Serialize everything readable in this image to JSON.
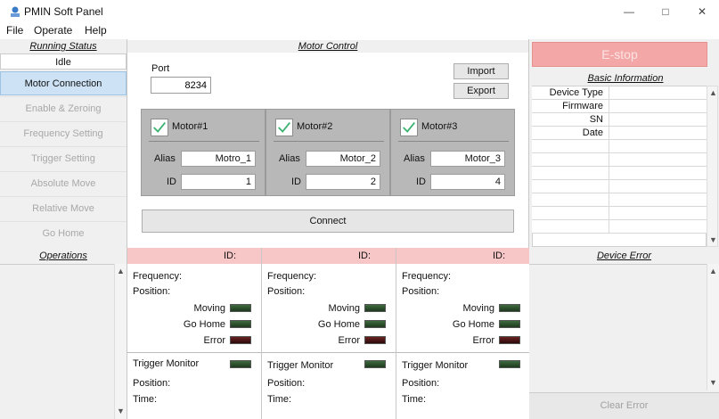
{
  "window": {
    "title": "PMIN Soft Panel",
    "minimize": "—",
    "maximize": "□",
    "close": "✕"
  },
  "menu": [
    "File",
    "Operate",
    "Help"
  ],
  "running_status": {
    "header": "Running Status",
    "value": "Idle"
  },
  "nav": [
    {
      "label": "Motor Connection",
      "active": true
    },
    {
      "label": "Enable & Zeroing",
      "active": false
    },
    {
      "label": "Frequency Setting",
      "active": false
    },
    {
      "label": "Trigger Setting",
      "active": false
    },
    {
      "label": "Absolute Move",
      "active": false
    },
    {
      "label": "Relative Move",
      "active": false
    },
    {
      "label": "Go Home",
      "active": false
    }
  ],
  "motor_control": {
    "header": "Motor Control",
    "port_label": "Port",
    "port_value": "8234",
    "import_label": "Import",
    "export_label": "Export",
    "connect_label": "Connect",
    "motors": [
      {
        "name": "Motor#1",
        "alias_label": "Alias",
        "alias": "Motro_1",
        "id_label": "ID",
        "id": "1"
      },
      {
        "name": "Motor#2",
        "alias_label": "Alias",
        "alias": "Motor_2",
        "id_label": "ID",
        "id": "2"
      },
      {
        "name": "Motor#3",
        "alias_label": "Alias",
        "alias": "Motor_3",
        "id_label": "ID",
        "id": "4"
      }
    ]
  },
  "estop_label": "E-stop",
  "basic_info": {
    "header": "Basic Information",
    "rows": [
      "Device Type",
      "Firmware",
      "SN",
      "Date"
    ]
  },
  "operations_header": "Operations",
  "monitors": [
    {
      "id_label": "ID:",
      "frequency": "Frequency:",
      "position": "Position:",
      "moving": "Moving",
      "go_home": "Go Home",
      "error": "Error",
      "trigger": "Trigger Monitor",
      "position2": "Position:",
      "time": "Time:"
    },
    {
      "id_label": "ID:",
      "frequency": "Frequency:",
      "position": "Position:",
      "moving": "Moving",
      "go_home": "Go Home",
      "error": "Error",
      "trigger": "Trigger Monitor",
      "position2": "Position:",
      "time": "Time:"
    },
    {
      "id_label": "ID:",
      "frequency": "Frequency:",
      "position": "Position:",
      "moving": "Moving",
      "go_home": "Go Home",
      "error": "Error",
      "trigger": "Trigger Monitor",
      "position2": "Position:",
      "time": "Time:"
    }
  ],
  "device_error": {
    "header": "Device Error",
    "clear_label": "Clear Error"
  },
  "colors": {
    "estop": "#f4a7a7",
    "id_header": "#f7c6c6",
    "active_nav": "#cde3f5",
    "led_green": "#2f552f",
    "led_red": "#4a1515",
    "check_green": "#3cb371"
  }
}
